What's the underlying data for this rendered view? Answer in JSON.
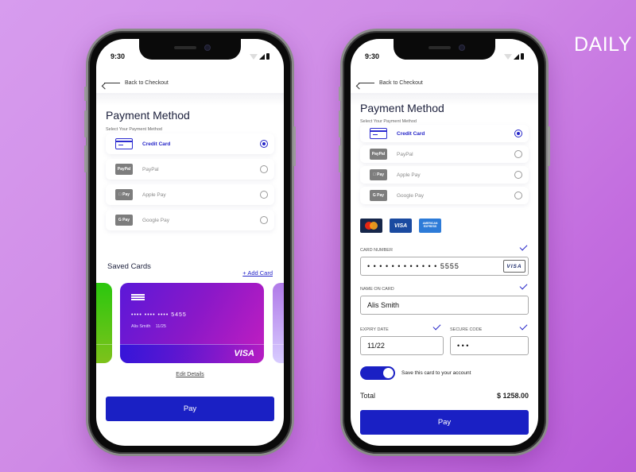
{
  "brand": "DAILY",
  "colors": {
    "accent": "#1a20c4",
    "selected": "#2525c8",
    "background": "#cf8ae6"
  },
  "phone1": {
    "status_time": "9:30",
    "back_label": "Back to Checkout",
    "title": "Payment Method",
    "subtitle": "Select Your Payment Method",
    "methods": [
      {
        "label": "Credit Card",
        "icon": "credit-card-icon",
        "badge": "",
        "selected": true
      },
      {
        "label": "PayPal",
        "icon": "paypal-icon",
        "badge": "PayPal",
        "selected": false
      },
      {
        "label": "Apple Pay",
        "icon": "apple-pay-icon",
        "badge": " Pay",
        "selected": false
      },
      {
        "label": "Google Pay",
        "icon": "google-pay-icon",
        "badge": "G Pay",
        "selected": false
      }
    ],
    "saved_cards_title": "Saved Cards",
    "add_card_label": "+ Add Card",
    "card": {
      "number": "••••  ••••  ••••   5455",
      "holder": "Alis Smith",
      "expiry": "11/25",
      "brand": "VISA"
    },
    "edit_details_label": "Edit Details",
    "pay_label": "Pay"
  },
  "phone2": {
    "status_time": "9:30",
    "back_label": "Back to Checkout",
    "title": "Payment Method",
    "subtitle": "Select Your Payment Method",
    "methods": [
      {
        "label": "Credit Card",
        "icon": "credit-card-icon",
        "badge": "",
        "selected": true
      },
      {
        "label": "PayPal",
        "icon": "paypal-icon",
        "badge": "PayPal",
        "selected": false
      },
      {
        "label": "Apple Pay",
        "icon": "apple-pay-icon",
        "badge": " Pay",
        "selected": false
      },
      {
        "label": "Google Pay",
        "icon": "google-pay-icon",
        "badge": "G Pay",
        "selected": false
      }
    ],
    "accepted_brands": [
      "Mastercard",
      "VISA",
      "AMERICAN EXPRESS"
    ],
    "card_number_label": "CARD NUMBER",
    "card_number_value": "• • • •   • • • •   • • • •   5555",
    "card_number_brand": "VISA",
    "name_label": "NAME ON CARD",
    "name_value": "Alis Smith",
    "expiry_label": "EXPIRY DATE",
    "expiry_value": "11/22",
    "cvv_label": "SECURE CODE",
    "cvv_value": "• • •",
    "save_card_label": "Save this card to your account",
    "save_card_on": true,
    "total_label": "Total",
    "total_value": "$ 1258.00",
    "pay_label": "Pay"
  }
}
